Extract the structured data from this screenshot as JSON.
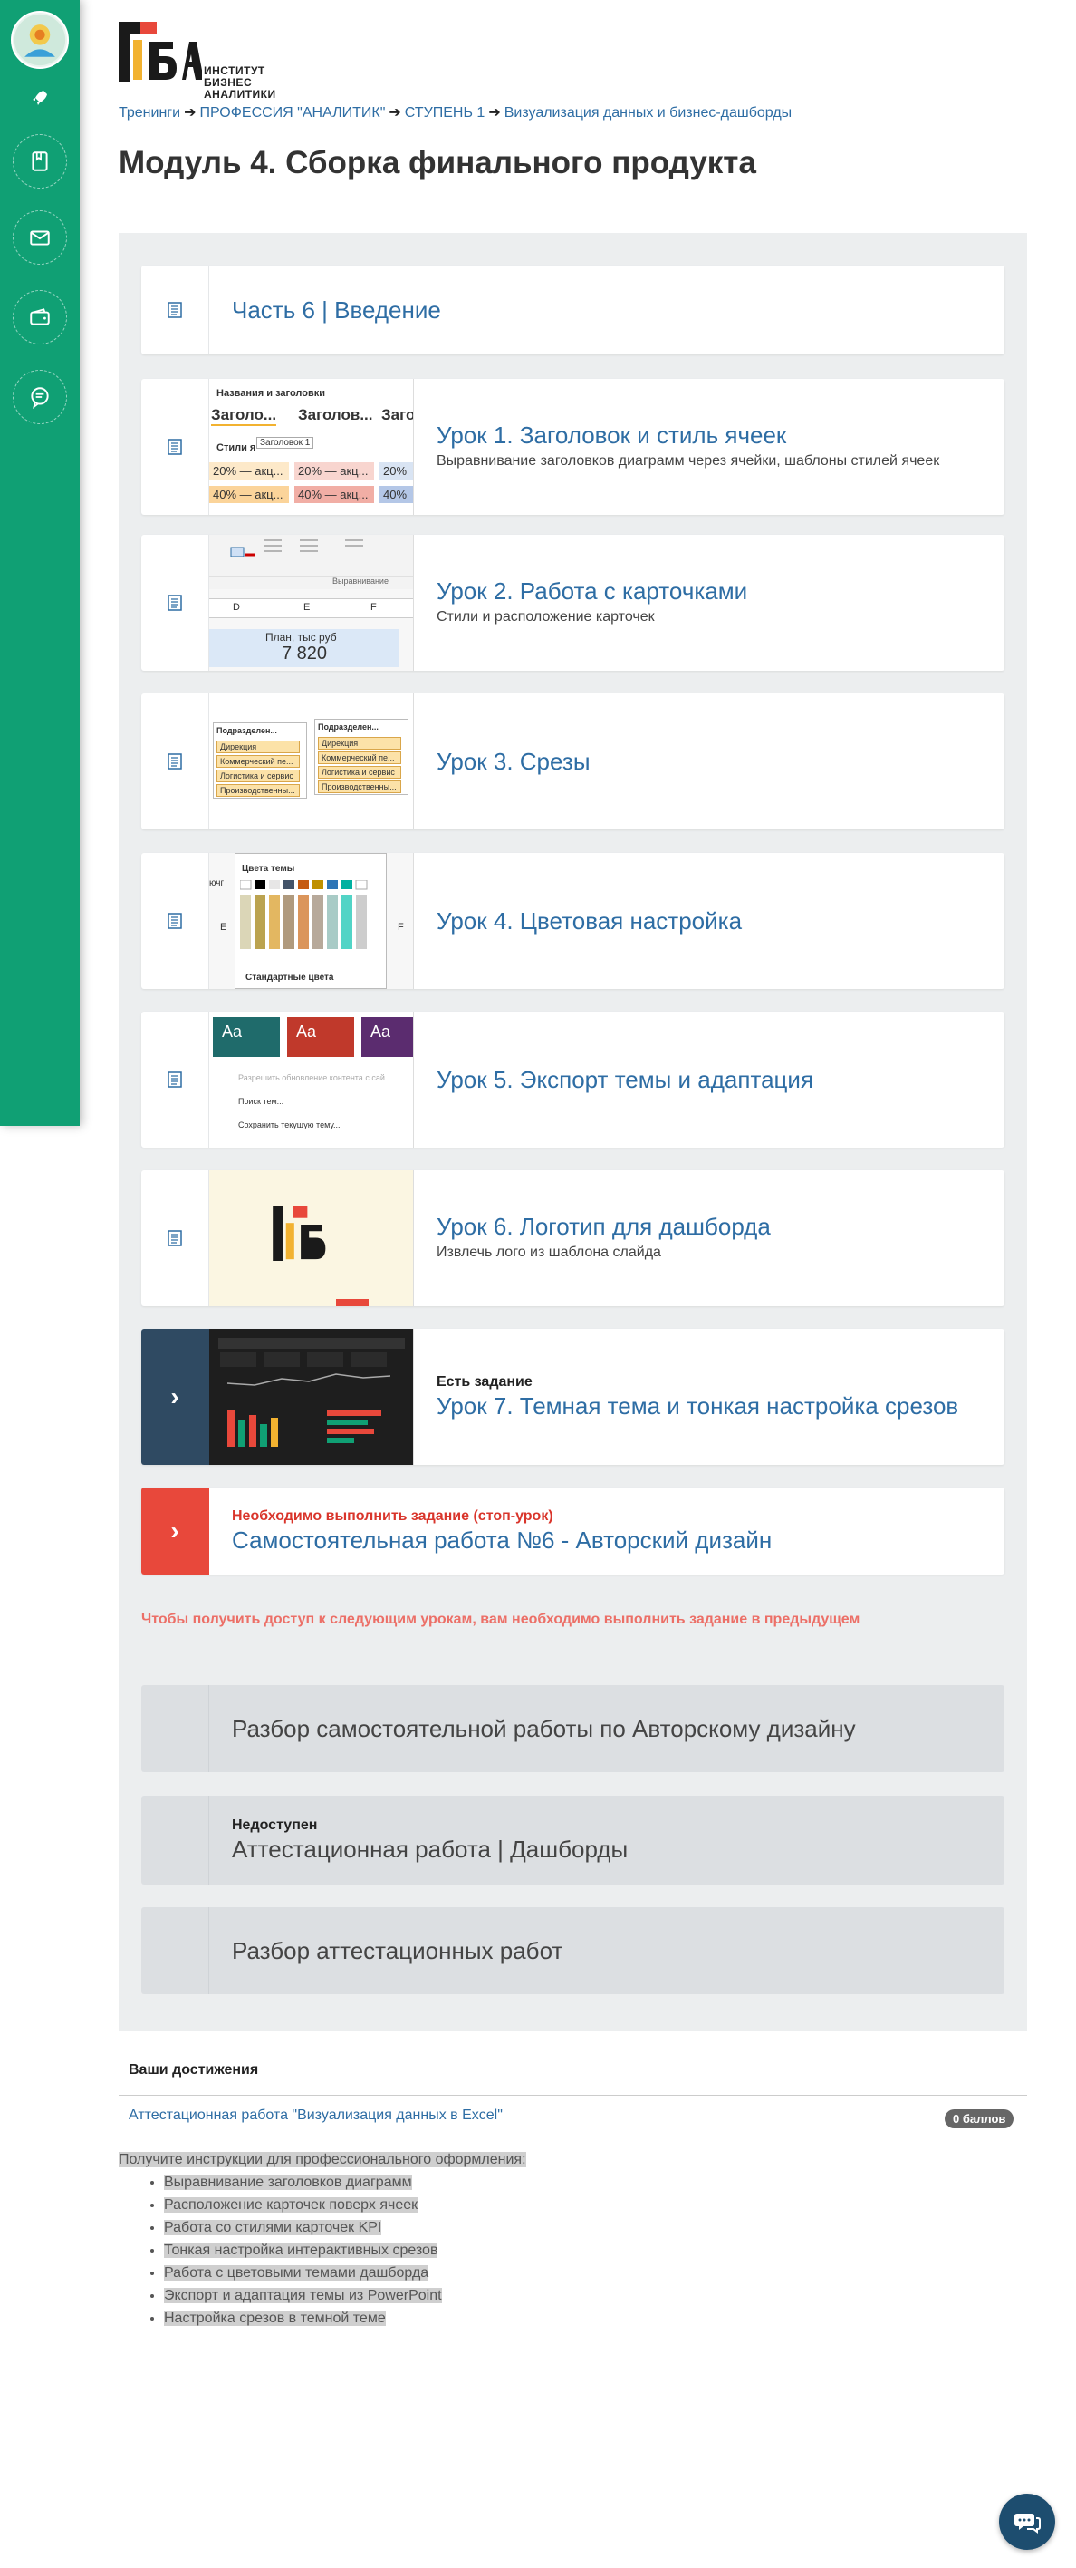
{
  "logo": {
    "line1": "ИНСТИТУТ",
    "line2": "БИЗНЕС",
    "line3": "АНАЛИТИКИ"
  },
  "breadcrumb": [
    {
      "label": "Тренинги"
    },
    {
      "label": "ПРОФЕССИЯ \"АНАЛИТИК\""
    },
    {
      "label": "СТУПЕНЬ 1"
    },
    {
      "label": "Визуализация данных и бизнес-дашборды"
    }
  ],
  "breadcrumb_sep": "➔",
  "page_title": "Модуль 4. Сборка финального продукта",
  "lessons": [
    {
      "title": "Часть 6 | Введение"
    },
    {
      "title": "Урок 1. Заголовок и стиль ячеек",
      "desc": "Выравнивание заголовков диаграмм через ячейки, шаблоны стилей ячеек"
    },
    {
      "title": "Урок 2. Работа с карточками",
      "desc": "Стили и расположение карточек"
    },
    {
      "title": "Урок 3. Срезы"
    },
    {
      "title": "Урок 4. Цветовая настройка"
    },
    {
      "title": "Урок 5. Экспорт темы и адаптация"
    },
    {
      "title": "Урок 6. Логотип для дашборда",
      "desc": "Извлечь лого из шаблона слайда"
    },
    {
      "tag": "Есть задание",
      "title": "Урок 7. Темная тема и тонкая настройка срезов"
    },
    {
      "tag": "Необходимо выполнить задание (стоп-урок)",
      "title": "Самостоятельная работа №6 - Авторский дизайн"
    }
  ],
  "locked_notice": "Чтобы получить доступ к следующим урокам, вам необходимо выполнить задание в предыдущем",
  "locked": [
    {
      "title": "Разбор самостоятельной работы по Авторскому дизайну"
    },
    {
      "tag": "Недоступен",
      "title": "Аттестационная работа | Дашборды"
    },
    {
      "title": "Разбор аттестационных работ"
    }
  ],
  "thumbs": {
    "t1": {
      "h": "Названия и заголовки",
      "a": "Заголо...",
      "b": "Заголов...",
      "c": "Загол",
      "tip": "Заголовок 1",
      "s": "Стили я",
      "r1": "20% — акц...",
      "r2": "40% — акц...",
      "r3": "20%",
      "r4": "40%"
    },
    "t2": {
      "c1": "D",
      "c2": "E",
      "c3": "F",
      "lbl": "Выравнивание",
      "plan": "План, тыс руб",
      "val": "7 820"
    },
    "t3": {
      "h1": "Подразделен...",
      "h2": "Подразделен...",
      "i1": "Дирекция",
      "i2": "Коммерческий пе...",
      "i3": "Логистика и сервис",
      "i4": "Производственны..."
    },
    "t4": {
      "h": "Цвета темы",
      "f": "Стандартные цвета",
      "e": "E",
      "fcol": "F",
      "g": "ючг"
    },
    "t5": {
      "aa": "Aa",
      "m1": "Разрешить обновление контента с сай",
      "m2": "Поиск тем...",
      "m3": "Сохранить текущую тему..."
    }
  },
  "achievements": {
    "heading": "Ваши достижения",
    "link": "Аттестационная работа \"Визуализация данных в Excel\"",
    "badge": "0 баллов"
  },
  "instructions": {
    "intro": "Получите инструкции для профессионального оформления:",
    "items": [
      "Выравнивание заголовков диаграмм",
      "Расположение карточек поверх ячеек",
      "Работа со стилями карточек KPI",
      "Тонкая настройка интерактивных срезов",
      "Работа с цветовыми темами дашборда",
      "Экспорт и адаптация темы из PowerPoint",
      "Настройка срезов в темной теме"
    ]
  },
  "colors": {
    "sidebar": "#10a074",
    "link": "#2e6da4",
    "stop": "#e8483b",
    "dark_gutter": "#2f4a62",
    "notice": "#ec6f67"
  }
}
